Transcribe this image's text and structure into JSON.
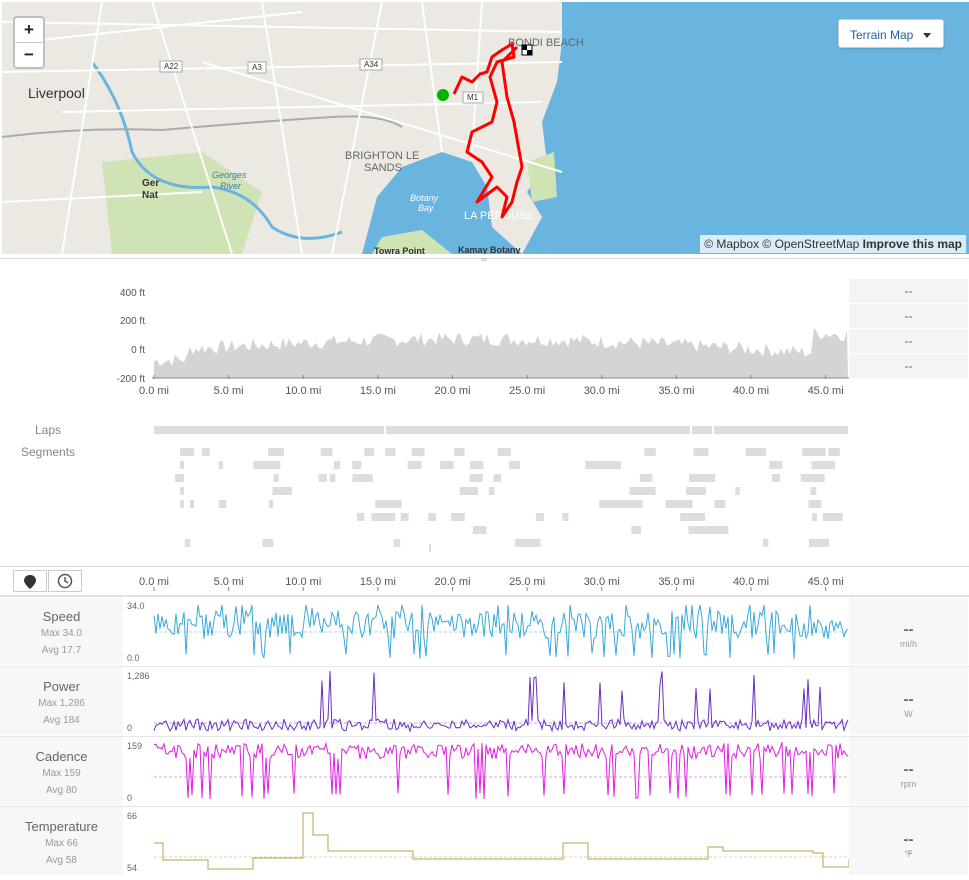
{
  "map": {
    "zoom_in": "+",
    "zoom_out": "−",
    "style_button": "Terrain Map",
    "attribution": "© Mapbox © OpenStreetMap",
    "improve": "Improve this map",
    "labels": {
      "liverpool": "Liverpool",
      "bondi": "BONDI BEACH",
      "brighton": "BRIGHTON LE",
      "sands": "SANDS",
      "botany": "Botany",
      "bay": "Bay",
      "perouse": "LA PEROUSE",
      "georges": "Georges",
      "river": "River",
      "towra": "Towra Point",
      "kamay": "Kamay Botany",
      "ger": "Ger",
      "nat": "Nat",
      "a22": "A22",
      "a3": "A3",
      "a34": "A34",
      "m1": "M1"
    },
    "colors": {
      "water": "#6ab4e0",
      "land": "#ece9e2",
      "route": "#ff0000",
      "start": "#00b300"
    }
  },
  "elevation": {
    "y_ticks": [
      "400 ft",
      "200 ft",
      "0 ft",
      "-200 ft"
    ],
    "stats": [
      "--",
      "--",
      "--",
      "--"
    ],
    "fill": "#d4d4d4"
  },
  "x_ticks": [
    "0.0 mi",
    "5.0 mi",
    "10.0 mi",
    "15.0 mi",
    "20.0 mi",
    "25.0 mi",
    "30.0 mi",
    "35.0 mi",
    "40.0 mi",
    "45.0 mi"
  ],
  "laps_label": "Laps",
  "segments_label": "Segments",
  "tabs": {
    "map_icon": "location-pin-icon",
    "time_icon": "clock-icon"
  },
  "streams": [
    {
      "key": "speed",
      "title": "Speed",
      "max": "Max 34.0",
      "avg": "Avg 17.7",
      "top": "34.0",
      "bottom": "0.0",
      "value": "--",
      "unit": "mi/h",
      "color": "#3aa9d9"
    },
    {
      "key": "power",
      "title": "Power",
      "max": "Max 1,286",
      "avg": "Avg 184",
      "top": "1,286",
      "bottom": "0",
      "value": "--",
      "unit": "W",
      "color": "#6a2fc0"
    },
    {
      "key": "cadence",
      "title": "Cadence",
      "max": "Max 159",
      "avg": "Avg 80",
      "top": "159",
      "bottom": "0",
      "value": "--",
      "unit": "rpm",
      "color": "#e01ee0"
    },
    {
      "key": "temp",
      "title": "Temperature",
      "max": "Max 66",
      "avg": "Avg 58",
      "top": "66",
      "bottom": "54",
      "value": "--",
      "unit": "℉",
      "color": "#b8a24a"
    }
  ]
}
